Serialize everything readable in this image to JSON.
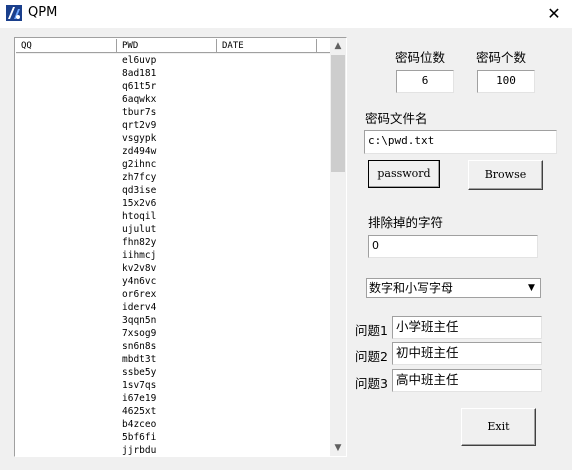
{
  "window": {
    "title": "QPM",
    "close_symbol": "✕"
  },
  "list": {
    "columns": [
      "QQ",
      "PWD",
      "DATE"
    ],
    "rows": [
      "el6uvp",
      "8ad181",
      "q61t5r",
      "6aqwkx",
      "tbur7s",
      "qrt2v9",
      "vsgypk",
      "zd494w",
      "g2ihnc",
      "zh7fcy",
      "qd3ise",
      "15x2v6",
      "htoqil",
      "ujulut",
      "fhn82y",
      "iihmcj",
      "kv2v8v",
      "y4n6vc",
      "or6rex",
      "iderv4",
      "3qqn5n",
      "7xsog9",
      "sn6n8s",
      "mbdt3t",
      "ssbe5y",
      "1sv7qs",
      "i67e19",
      "4625xt",
      "b4zceo",
      "5bf6fi",
      "jjrbdu"
    ],
    "scroll_up": "▲",
    "scroll_down": "▼"
  },
  "form": {
    "pwd_length_label": "密码位数",
    "pwd_length_value": "6",
    "pwd_count_label": "密码个数",
    "pwd_count_value": "100",
    "file_label": "密码文件名",
    "file_value": "c:\\pwd.txt",
    "password_button": "password",
    "browse_button": "Browse",
    "exclude_label": "排除掉的字符",
    "exclude_value": "0",
    "charset_selected": "数字和小写字母",
    "q1_label": "问题1",
    "q1_value": "小学班主任",
    "q2_label": "问题2",
    "q2_value": "初中班主任",
    "q3_label": "问题3",
    "q3_value": "高中班主任",
    "exit_button": "Exit"
  },
  "icons": {
    "app": "app-icon",
    "close": "close-icon",
    "dropdown": "chevron-down-icon"
  }
}
